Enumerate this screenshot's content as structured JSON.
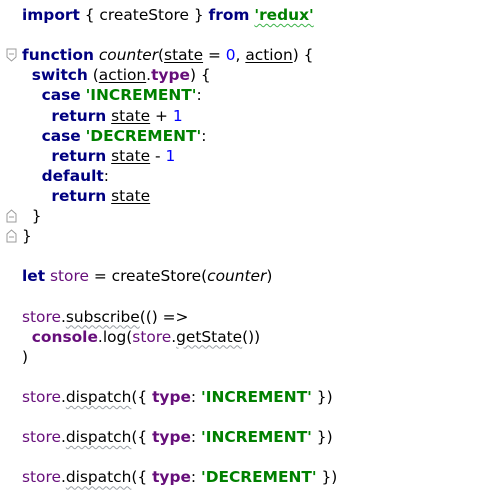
{
  "editor": {
    "colors": {
      "background": "#ffffff",
      "keyword": "#000080",
      "string": "#008000",
      "number": "#0000ff",
      "field": "#660e7a",
      "typo_underline": "#3db34a",
      "fold_marker": "#9b9b9b"
    },
    "lines": [
      [
        {
          "t": "import",
          "k": "kw"
        },
        {
          "t": " { createStore } "
        },
        {
          "t": "from",
          "k": "kw"
        },
        {
          "t": " "
        },
        {
          "t": "'redux'",
          "k": "str",
          "d": "typo"
        }
      ],
      [],
      [
        {
          "t": "function",
          "k": "kw"
        },
        {
          "t": " "
        },
        {
          "t": "counter",
          "k": "it"
        },
        {
          "t": "("
        },
        {
          "t": "state",
          "d": "u"
        },
        {
          "t": " = "
        },
        {
          "t": "0",
          "k": "num"
        },
        {
          "t": ", "
        },
        {
          "t": "action",
          "d": "u"
        },
        {
          "t": ") {"
        }
      ],
      [
        {
          "t": "  "
        },
        {
          "t": "switch",
          "k": "kw"
        },
        {
          "t": " ("
        },
        {
          "t": "action",
          "d": "u"
        },
        {
          "t": "."
        },
        {
          "t": "type",
          "k": "lbl"
        },
        {
          "t": ") {"
        }
      ],
      [
        {
          "t": "    "
        },
        {
          "t": "case",
          "k": "kw"
        },
        {
          "t": " "
        },
        {
          "t": "'INCREMENT'",
          "k": "str"
        },
        {
          "t": ":"
        }
      ],
      [
        {
          "t": "      "
        },
        {
          "t": "return",
          "k": "kw"
        },
        {
          "t": " "
        },
        {
          "t": "state",
          "d": "u"
        },
        {
          "t": " + "
        },
        {
          "t": "1",
          "k": "num"
        }
      ],
      [
        {
          "t": "    "
        },
        {
          "t": "case",
          "k": "kw"
        },
        {
          "t": " "
        },
        {
          "t": "'DECREMENT'",
          "k": "str"
        },
        {
          "t": ":"
        }
      ],
      [
        {
          "t": "      "
        },
        {
          "t": "return",
          "k": "kw"
        },
        {
          "t": " "
        },
        {
          "t": "state",
          "d": "u"
        },
        {
          "t": " - "
        },
        {
          "t": "1",
          "k": "num"
        }
      ],
      [
        {
          "t": "    "
        },
        {
          "t": "default",
          "k": "kw"
        },
        {
          "t": ":"
        }
      ],
      [
        {
          "t": "      "
        },
        {
          "t": "return",
          "k": "kw"
        },
        {
          "t": " "
        },
        {
          "t": "state",
          "d": "u"
        }
      ],
      [
        {
          "t": "  }"
        }
      ],
      [
        {
          "t": "}"
        }
      ],
      [],
      [
        {
          "t": "let",
          "k": "kw"
        },
        {
          "t": " "
        },
        {
          "t": "store",
          "k": "fld"
        },
        {
          "t": " = createStore("
        },
        {
          "t": "counter",
          "k": "it"
        },
        {
          "t": ")"
        }
      ],
      [],
      [
        {
          "t": "store",
          "k": "fld"
        },
        {
          "t": "."
        },
        {
          "t": "subscribe",
          "d": "warn"
        },
        {
          "t": "(() =>"
        }
      ],
      [
        {
          "t": "  "
        },
        {
          "t": "console",
          "k": "lbl"
        },
        {
          "t": "."
        },
        {
          "t": "log"
        },
        {
          "t": "("
        },
        {
          "t": "store",
          "k": "fld"
        },
        {
          "t": "."
        },
        {
          "t": "getState",
          "d": "warn"
        },
        {
          "t": "())"
        }
      ],
      [
        {
          "t": ")"
        }
      ],
      [],
      [
        {
          "t": "store",
          "k": "fld"
        },
        {
          "t": "."
        },
        {
          "t": "dispatch",
          "d": "warn"
        },
        {
          "t": "({ "
        },
        {
          "t": "type",
          "k": "lbl"
        },
        {
          "t": ": "
        },
        {
          "t": "'INCREMENT'",
          "k": "str"
        },
        {
          "t": " })"
        }
      ],
      [],
      [
        {
          "t": "store",
          "k": "fld"
        },
        {
          "t": "."
        },
        {
          "t": "dispatch",
          "d": "warn"
        },
        {
          "t": "({ "
        },
        {
          "t": "type",
          "k": "lbl"
        },
        {
          "t": ": "
        },
        {
          "t": "'INCREMENT'",
          "k": "str"
        },
        {
          "t": " })"
        }
      ],
      [],
      [
        {
          "t": "store",
          "k": "fld"
        },
        {
          "t": "."
        },
        {
          "t": "dispatch",
          "d": "warn"
        },
        {
          "t": "({ "
        },
        {
          "t": "type",
          "k": "lbl"
        },
        {
          "t": ": "
        },
        {
          "t": "'DECREMENT'",
          "k": "str"
        },
        {
          "t": " })"
        }
      ]
    ],
    "fold_markers": [
      {
        "line": 2,
        "icon": "fold-open-icon"
      },
      {
        "line": 10,
        "icon": "fold-close-icon"
      },
      {
        "line": 11,
        "icon": "fold-close-icon"
      }
    ]
  }
}
